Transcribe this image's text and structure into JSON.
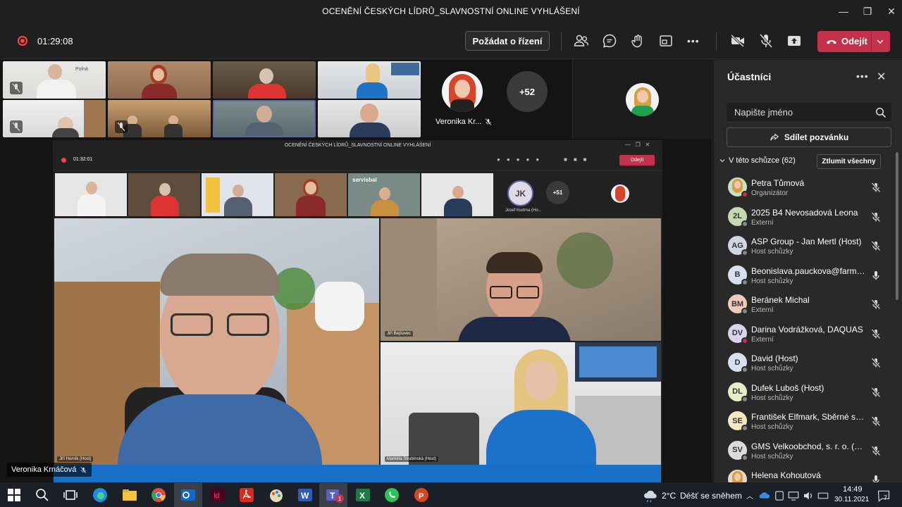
{
  "window": {
    "title": "OCENĚNÍ ČESKÝCH LÍDRŮ_SLAVNOSTNÍ ONLINE VYHLÁŠENÍ",
    "minimize": "—",
    "maximize": "❐",
    "close": "✕"
  },
  "toolbar": {
    "timer": "01:29:08",
    "request_control_label": "Požádat o řízení",
    "leave_label": "Odejít",
    "more": "•••"
  },
  "stage": {
    "thumb_top_text": "Polná",
    "featured_name": "Veronika Kr...",
    "more_count": "+52",
    "screen_sharer": "Veronika Krnáčová"
  },
  "shared": {
    "title": "OCENĚNÍ ČESKÝCH LÍDRŮ_SLAVNOSTNÍ ONLINE VYHLÁŠENÍ",
    "timer": "01:32:01",
    "leave_label": "Odejít",
    "initials": "JK",
    "initials_name": "Josef Kudrna (Ho...",
    "more_count": "+51",
    "brand": "servisbal",
    "labels": {
      "main": "Jiří Horník (Host)",
      "top_right": "Jiří Bejšovec",
      "bottom_right": "Markéta Štrubínská (Host)"
    }
  },
  "panel": {
    "title": "Účastníci",
    "more": "•••",
    "close": "✕",
    "search_placeholder": "Napište jméno",
    "invite_label": "Sdílet pozvánku",
    "section_label": "V této schůzce (62)",
    "mute_all_label": "Ztlumit všechny",
    "participants": [
      {
        "initials": "",
        "name": "Petra Tůmová",
        "role": "Organizátor",
        "avatar_color": "#c8e0c8",
        "status": "#c4314b",
        "photo": true
      },
      {
        "initials": "2L",
        "name": "2025 B4 Nevosadová Leona",
        "role": "Externí",
        "avatar_color": "#c5d9b0",
        "status": "#888888",
        "photo": false
      },
      {
        "initials": "AG",
        "name": "ASP Group - Jan Mertl (Host)",
        "role": "Host schůzky",
        "avatar_color": "#cfd7e3",
        "status": "#888888",
        "photo": false
      },
      {
        "initials": "B",
        "name": "Beonislava.pauckova@farmak...",
        "role": "Host schůzky",
        "avatar_color": "#d6e0f0",
        "status": "#888888",
        "photo": false
      },
      {
        "initials": "BM",
        "name": "Beránek Michal",
        "role": "Externí",
        "avatar_color": "#f0c8bc",
        "status": "#888888",
        "photo": false
      },
      {
        "initials": "DV",
        "name": "Darina Vodrážková, DAQUAS",
        "role": "Externí",
        "avatar_color": "#d9d4ee",
        "status": "#c4314b",
        "photo": false
      },
      {
        "initials": "D",
        "name": "David (Host)",
        "role": "Host schůzky",
        "avatar_color": "#d6e0f0",
        "status": "#888888",
        "photo": false
      },
      {
        "initials": "DL",
        "name": "Dufek Luboš (Host)",
        "role": "Host schůzky",
        "avatar_color": "#e6ecc4",
        "status": "#888888",
        "photo": false
      },
      {
        "initials": "SE",
        "name": "František Elfmark, Sběrné sur...",
        "role": "Host schůzky",
        "avatar_color": "#f6e8c0",
        "status": "#888888",
        "photo": false
      },
      {
        "initials": "SV",
        "name": "GMS Velkoobchod, s. r. o. (Ho...",
        "role": "Host schůzky",
        "avatar_color": "#dcdcdc",
        "status": "#888888",
        "photo": false
      },
      {
        "initials": "",
        "name": "Helena Kohoutová",
        "role": "",
        "avatar_color": "#e8d8c8",
        "status": "#888888",
        "photo": true
      }
    ]
  },
  "taskbar": {
    "temperature": "2°C",
    "weather": "Déšť se sněhem",
    "time": "14:49",
    "date": "30.11.2021",
    "notifications": "7",
    "teams_badge": "1"
  }
}
